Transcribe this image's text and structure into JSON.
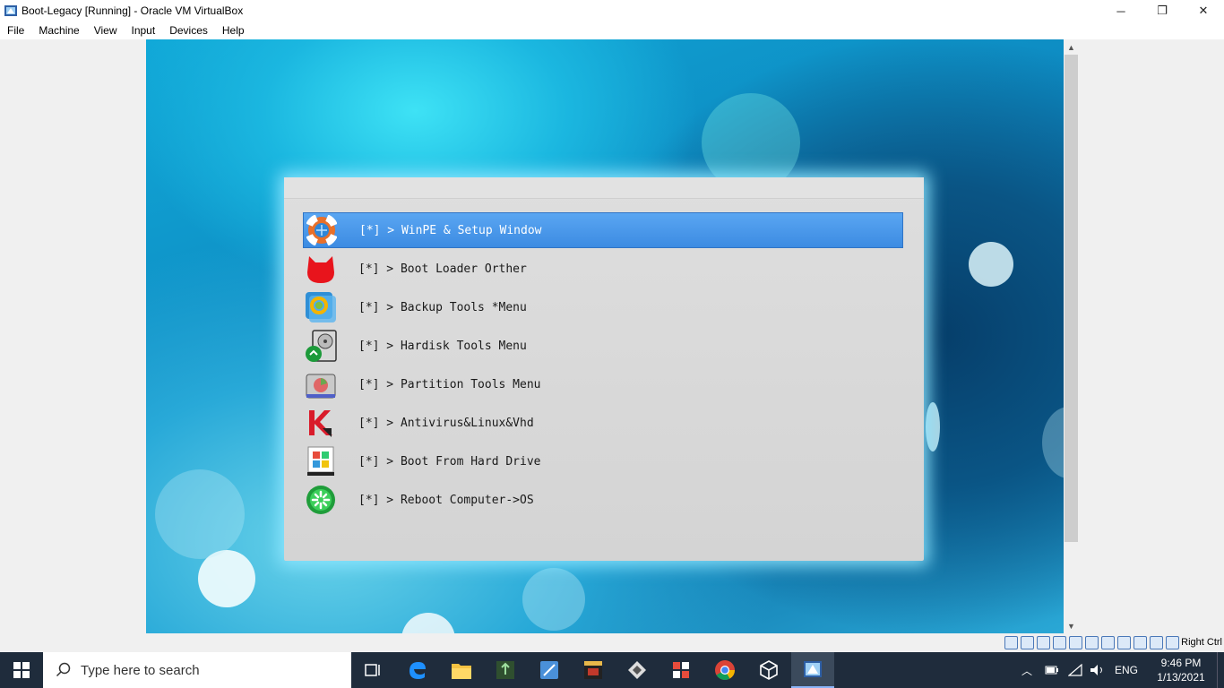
{
  "window": {
    "title": "Boot-Legacy [Running] - Oracle VM VirtualBox",
    "minimize_glyph": "─",
    "maximize_glyph": "❐",
    "close_glyph": "✕"
  },
  "menubar": {
    "items": [
      "File",
      "Machine",
      "View",
      "Input",
      "Devices",
      "Help"
    ]
  },
  "boot_menu": {
    "items": [
      {
        "label": "[*] > WinPE & Setup Window",
        "icon": "lifebuoy-icon",
        "selected": true
      },
      {
        "label": "[*] > Boot Loader Orther",
        "icon": "red-cat-icon",
        "selected": false
      },
      {
        "label": "[*] > Backup Tools *Menu",
        "icon": "backup-icon",
        "selected": false
      },
      {
        "label": "[*] > Hardisk Tools Menu",
        "icon": "harddisk-icon",
        "selected": false
      },
      {
        "label": "[*] > Partition Tools Menu",
        "icon": "partition-icon",
        "selected": false
      },
      {
        "label": "[*] > Antivirus&Linux&Vhd",
        "icon": "kaspersky-icon",
        "selected": false
      },
      {
        "label": "[*] > Boot From Hard Drive",
        "icon": "windows-drive-icon",
        "selected": false
      },
      {
        "label": "[*] > Reboot Computer->OS",
        "icon": "reboot-icon",
        "selected": false
      }
    ]
  },
  "statusbar": {
    "host_key": "Right Ctrl"
  },
  "taskbar": {
    "search_placeholder": "Type here to search",
    "language": "ENG",
    "time": "9:46 PM",
    "date": "1/13/2021"
  },
  "colors": {
    "selection": "#3c8be2",
    "taskbar": "#1f2c3c"
  }
}
